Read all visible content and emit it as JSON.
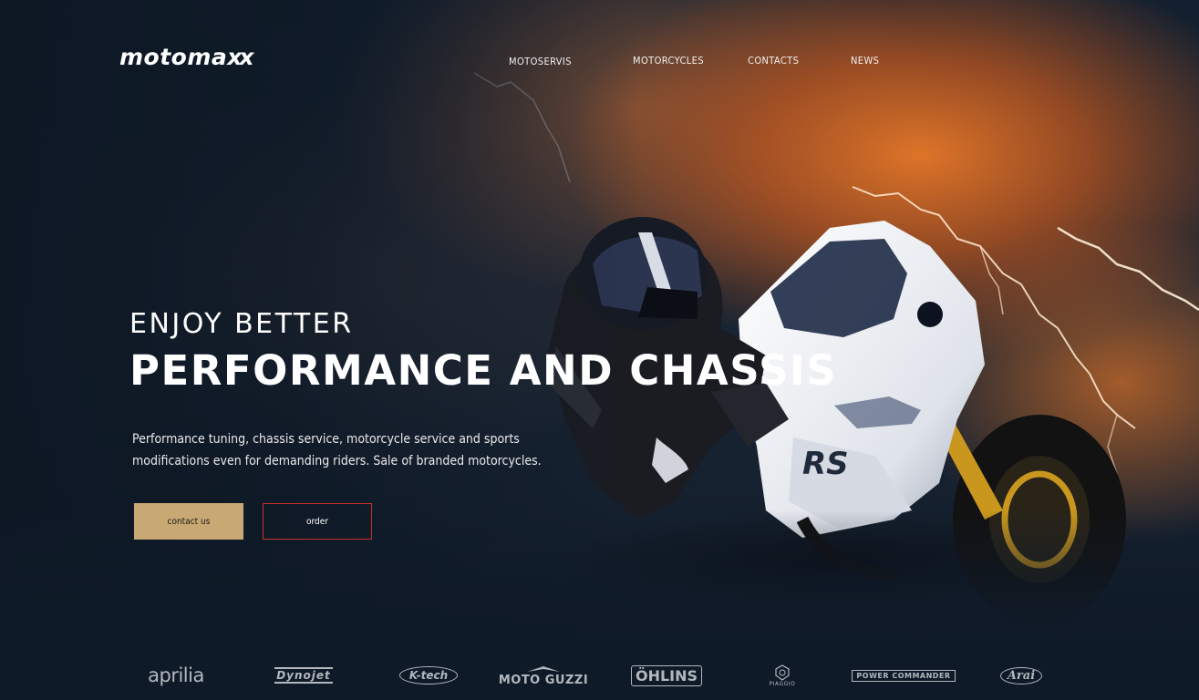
{
  "brand": {
    "logo_main": "motoma",
    "logo_suffix": "xx"
  },
  "nav": {
    "items": [
      {
        "label": "MOTOSERVIS"
      },
      {
        "label": "MOTORCYCLES"
      },
      {
        "label": "CONTACTS"
      },
      {
        "label": "NEWS"
      }
    ]
  },
  "hero": {
    "eyebrow": "ENJOY BETTER",
    "headline": "PERFORMANCE AND CHASSIS",
    "description": "Performance tuning, chassis service, motorcycle service and sports modifications even for demanding riders. Sale of branded motorcycles.",
    "image_icon": "motorcycle-rider-photo"
  },
  "actions": {
    "contact_label": "contact us",
    "order_label": "order"
  },
  "brands": [
    {
      "name": "aprilia"
    },
    {
      "name": "Dynojet"
    },
    {
      "name": "K-tech"
    },
    {
      "name": "MOTO GUZZI"
    },
    {
      "name": "ÖHLINS"
    },
    {
      "name": "PIAGGIO"
    },
    {
      "name": "POWER COMMANDER"
    },
    {
      "name": "Arai"
    }
  ],
  "colors": {
    "accent_gold": "#c8a873",
    "order_border": "#c9302c",
    "background_dark": "#0f1a28",
    "sky_orange": "#e87828"
  }
}
